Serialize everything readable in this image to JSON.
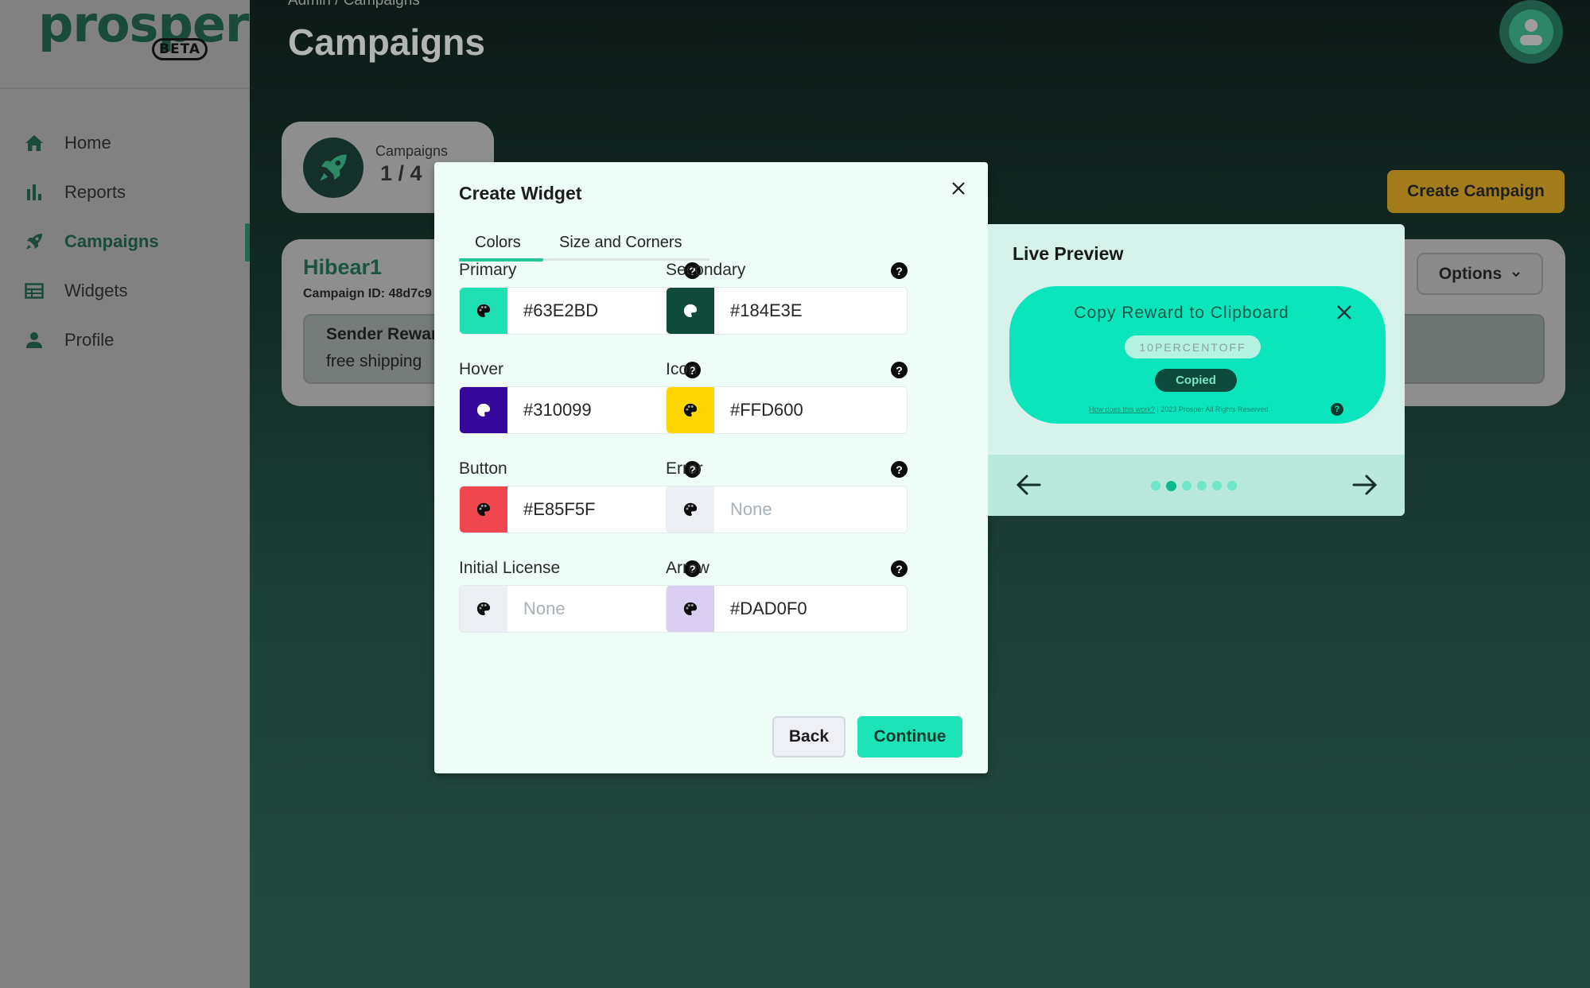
{
  "sidebar": {
    "logo": "prosper",
    "logo_badge": "BETA",
    "items": [
      {
        "label": "Home",
        "icon": "home-icon",
        "active": false
      },
      {
        "label": "Reports",
        "icon": "bar-chart-icon",
        "active": false
      },
      {
        "label": "Campaigns",
        "icon": "rocket-icon",
        "active": true
      },
      {
        "label": "Widgets",
        "icon": "widget-layout-icon",
        "active": false
      },
      {
        "label": "Profile",
        "icon": "person-icon",
        "active": false
      }
    ]
  },
  "header": {
    "breadcrumb": "Admin  /  Campaigns",
    "title": "Campaigns"
  },
  "stats": {
    "label": "Campaigns",
    "value": "1 / 4"
  },
  "actions": {
    "create_campaign": "Create Campaign",
    "options": "Options"
  },
  "campaign": {
    "name": "Hibear1",
    "id_text": "Campaign ID:  48d7c9",
    "reward_title": "Sender Reward",
    "reward_desc": "free shipping"
  },
  "modal": {
    "title": "Create Widget",
    "tabs": [
      {
        "label": "Colors",
        "active": true
      },
      {
        "label": "Size and Corners",
        "active": false
      }
    ],
    "fields": [
      {
        "label": "Primary",
        "value": "#63E2BD",
        "swatch": "#1fe0b2",
        "icon_color": "#0d0d0d",
        "placeholder": false
      },
      {
        "label": "Secondary",
        "value": "#184E3E",
        "swatch": "#0f4a3b",
        "icon_color": "#ffffff",
        "placeholder": false
      },
      {
        "label": "Hover",
        "value": "#310099",
        "swatch": "#34089a",
        "icon_color": "#ffffff",
        "placeholder": false
      },
      {
        "label": "Icon",
        "value": "#FFD600",
        "swatch": "#ffd600",
        "icon_color": "#0d0d0d",
        "placeholder": false
      },
      {
        "label": "Button",
        "value": "#E85F5F",
        "swatch": "#f0474f",
        "icon_color": "#0d0d0d",
        "placeholder": false
      },
      {
        "label": "Error",
        "value": "None",
        "swatch": "#eceff4",
        "icon_color": "#0d0d0d",
        "placeholder": true
      },
      {
        "label": "Initial License",
        "value": "None",
        "swatch": "#eceff4",
        "icon_color": "#0d0d0d",
        "placeholder": true
      },
      {
        "label": "Arrow",
        "value": "#DAD0F0",
        "swatch": "#dacff0",
        "icon_color": "#0d0d0d",
        "placeholder": false
      }
    ],
    "help_glyph": "?",
    "back": "Back",
    "continue": "Continue"
  },
  "preview": {
    "title": "Live Preview",
    "widget_title": "Copy Reward to Clipboard",
    "code": "10PERCENTOFF",
    "copied": "Copied",
    "footer_link": "How does this work?",
    "footer_text": " | 2023 Prosper All Rights Reserved",
    "help_glyph": "?",
    "dots_total": 6,
    "dots_active_index": 1
  }
}
